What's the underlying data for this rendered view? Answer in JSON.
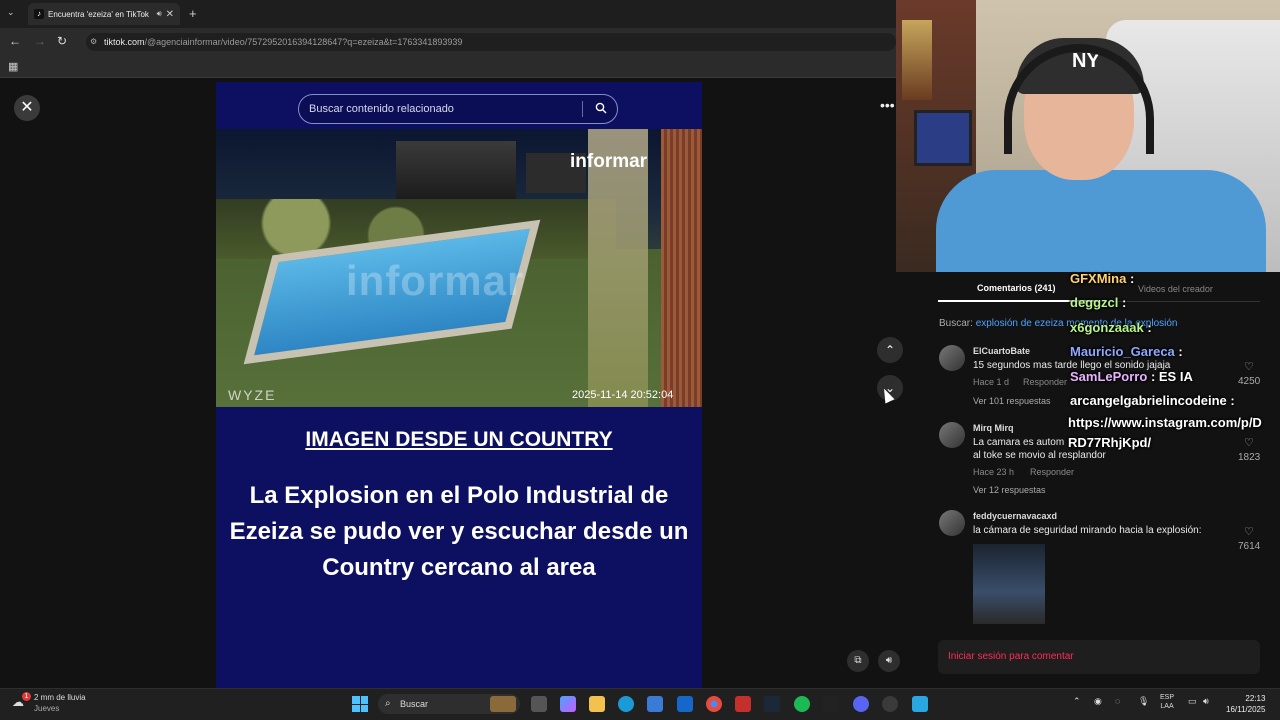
{
  "browser": {
    "tab_title": "Encuentra 'ezeiza' en TikTok",
    "url_host": "tiktok.com",
    "url_path": "/@agenciainformar/video/7572952016394128647?q=ezeiza&t=1763341893939"
  },
  "video": {
    "search_placeholder": "Buscar contenido relacionado",
    "brand": "informar",
    "watermark": "informar",
    "camera_brand": "WYZE",
    "timestamp": "2025-11-14 20:52:04",
    "headline": "IMAGEN DESDE UN COUNTRY",
    "body": "La Explosion en el Polo Industrial de Ezeiza se pudo ver y escuchar desde un Country cercano al area"
  },
  "comments_panel": {
    "tab_comments": "Comentarios (241)",
    "tab_videos": "Videos del creador",
    "search_label": "Buscar:",
    "search_query": "explosión de ezeiza momento de la explosión",
    "comments": [
      {
        "user": "ElCuartoBate",
        "text": "15 segundos mas tarde llego el sonido jajaja",
        "time": "Hace 1 d",
        "reply": "Responder",
        "replies": "Ver 101 respuestas",
        "likes": "4250"
      },
      {
        "user": "Mirq Mirq",
        "text_line1": "La camara es autom",
        "text_line2": "al toke se movio al resplandor",
        "time": "Hace 23 h",
        "reply": "Responder",
        "replies": "Ver 12 respuestas",
        "likes": "1823"
      },
      {
        "user": "feddycuernavacaxd",
        "text": "la cámara de seguridad mirando hacia la explosión:",
        "likes": "7614"
      }
    ],
    "login_prompt": "Iniciar sesión para comentar"
  },
  "stream_chat": [
    {
      "name": "GFXMina",
      "text": ":"
    },
    {
      "name": "deggzcl",
      "text": ":"
    },
    {
      "name": "x6gonzaaak",
      "text": ":"
    },
    {
      "name": "Mauricio_Gareca",
      "text": ":"
    },
    {
      "name": "SamLePorro",
      "text": ": ES IA"
    },
    {
      "name": "arcangelgabrielincodeine",
      "text": ":"
    },
    {
      "name": "",
      "text": "https://www.instagram.com/p/D"
    },
    {
      "name": "",
      "text": "RD77RhjKpd/"
    }
  ],
  "taskbar": {
    "weather_text": "2 mm de lluvia",
    "weather_day": "Jueves",
    "weather_badge": "1",
    "search_label": "Buscar",
    "lang": "ESP",
    "lang2": "LAA",
    "time": "22:13",
    "date": "16/11/2025"
  },
  "colors": {
    "video_bg": "#0d1060",
    "login_accent": "#fe2c55",
    "query_link": "#4da3ff"
  }
}
